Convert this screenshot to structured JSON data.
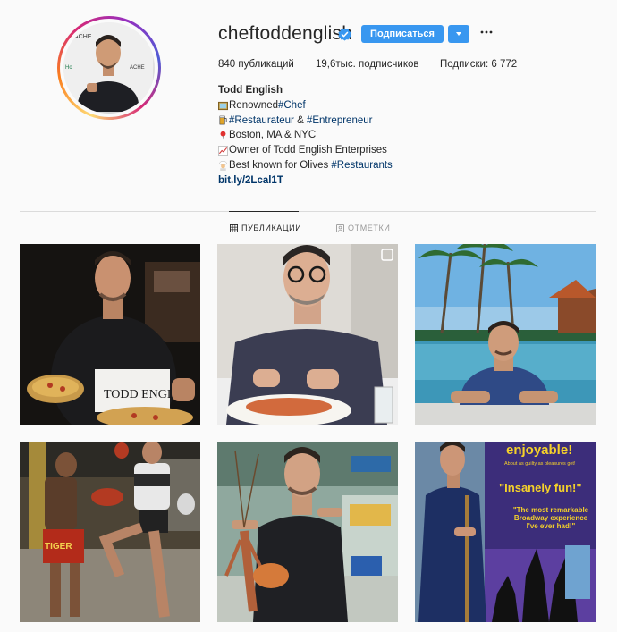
{
  "profile": {
    "username": "cheftoddenglish",
    "follow_label": "Подписаться",
    "stats": {
      "posts": "840 публикаций",
      "followers": "19,6тыс. подписчиков",
      "following": "Подписки: 6 772"
    },
    "full_name": "Todd English",
    "bio": {
      "line1_text": "Renowned ",
      "line1_tag": "#Chef",
      "line2_tag1": "#Restaurateur",
      "line2_amp": " & ",
      "line2_tag2": "#Entrepreneur",
      "line3_text": "Boston, MA & NYC",
      "line4_text": "Owner of Todd English Enterprises",
      "line5_text": "Best known for Olives ",
      "line5_tag": "#Restaurants",
      "link": "bit.ly/2Lcal1T"
    }
  },
  "tabs": [
    {
      "label": "ПУБЛИКАЦИИ",
      "active": true
    },
    {
      "label": "ОТМЕТКИ",
      "active": false
    }
  ],
  "posts": [
    {
      "caption_text": "TODD ENGLISH"
    },
    {},
    {},
    {
      "caption_text": "TIGER"
    },
    {},
    {
      "caption_text": "enjoyable!",
      "caption_text2": "\"Insanely fun!\"",
      "caption_text3": "\"The most remarkable Broadway experience I've ever had!\"",
      "caption_text4": "About as guilty as pleasures get!"
    }
  ],
  "colors": {
    "accent": "#3897f0",
    "link": "#003569",
    "verified": "#3897f0"
  }
}
